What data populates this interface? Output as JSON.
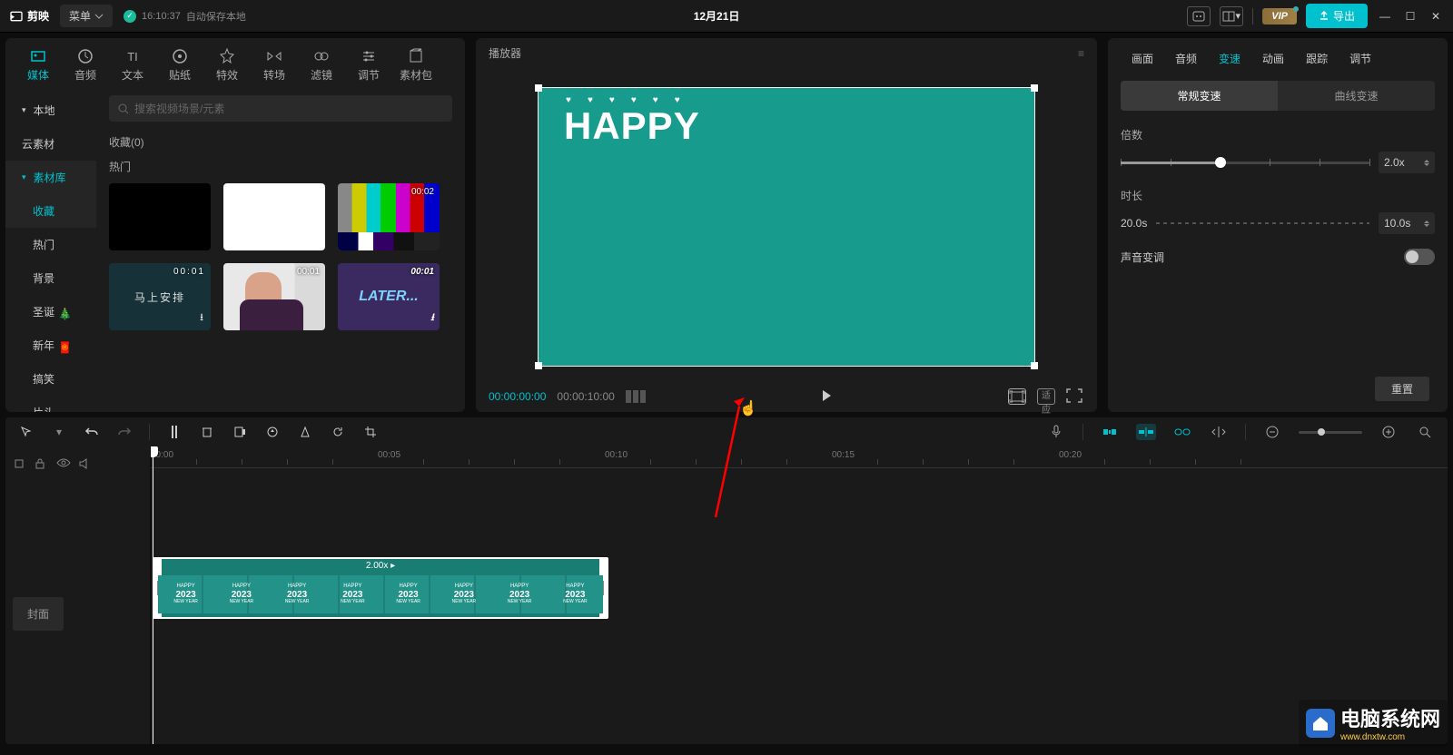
{
  "topbar": {
    "app_name": "剪映",
    "menu_label": "菜单",
    "autosave_time": "16:10:37",
    "autosave_text": "自动保存本地",
    "title": "12月21日",
    "vip": "VIP",
    "export": "导出"
  },
  "top_tabs": [
    {
      "label": "媒体",
      "active": true
    },
    {
      "label": "音频"
    },
    {
      "label": "文本"
    },
    {
      "label": "贴纸"
    },
    {
      "label": "特效"
    },
    {
      "label": "转场"
    },
    {
      "label": "滤镜"
    },
    {
      "label": "调节"
    },
    {
      "label": "素材包"
    }
  ],
  "side_nav": [
    {
      "label": "本地",
      "expanded": true
    },
    {
      "label": "云素材"
    },
    {
      "label": "素材库",
      "active": true,
      "expanded": true
    },
    {
      "label": "收藏",
      "sub": true,
      "active": true
    },
    {
      "label": "热门",
      "sub": true
    },
    {
      "label": "背景",
      "sub": true
    },
    {
      "label": "圣诞",
      "sub": true,
      "badge": "🎄"
    },
    {
      "label": "新年",
      "sub": true,
      "badge": "🧧"
    },
    {
      "label": "搞笑",
      "sub": true
    },
    {
      "label": "片头",
      "sub": true
    }
  ],
  "library": {
    "search_placeholder": "搜索视频场景/元素",
    "fav_label": "收藏(0)",
    "hot_label": "热门",
    "thumbs": [
      {
        "dur": "",
        "cls": "black"
      },
      {
        "dur": "",
        "cls": "white"
      },
      {
        "dur": "00:02",
        "cls": "colorbar"
      },
      {
        "dur": "00:01",
        "cls": "teal",
        "text": "马上安排"
      },
      {
        "dur": "00:01",
        "cls": "man"
      },
      {
        "dur": "00:01",
        "cls": "later",
        "text": "LATER..."
      }
    ]
  },
  "preview": {
    "title": "播放器",
    "happy": "HAPPY",
    "time_current": "00:00:00:00",
    "time_total": "00:00:10:00",
    "fit_label": "适应"
  },
  "right": {
    "tabs": [
      {
        "label": "画面"
      },
      {
        "label": "音频"
      },
      {
        "label": "变速",
        "active": true
      },
      {
        "label": "动画"
      },
      {
        "label": "跟踪"
      },
      {
        "label": "调节"
      }
    ],
    "speed_tabs": [
      {
        "label": "常规变速",
        "active": true
      },
      {
        "label": "曲线变速"
      }
    ],
    "multiplier_label": "倍数",
    "multiplier_value": "2.0x",
    "duration_label": "时长",
    "duration_from": "20.0s",
    "duration_to": "10.0s",
    "pitch_label": "声音变调",
    "reset": "重置"
  },
  "timeline": {
    "ruler": [
      "00:00",
      "|00:05",
      "|00:10",
      "|00:15",
      "|00:20"
    ],
    "cover": "封面",
    "clip_speed": "2.00x ▸",
    "frame_text": "HAPPY 2023 NEW YEAR"
  },
  "watermark": {
    "text": "电脑系统网",
    "sub": "www.dnxtw.com"
  }
}
